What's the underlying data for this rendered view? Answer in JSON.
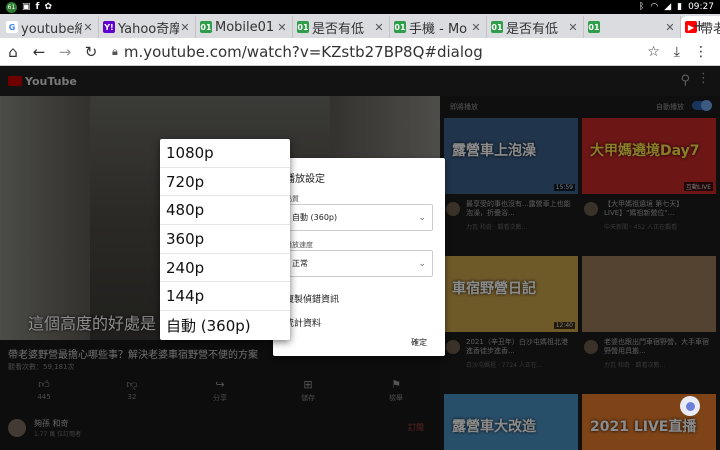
{
  "status_bar": {
    "left_icons": [
      "notification-badge-icon",
      "photo-icon",
      "facebook-icon",
      "battery-saver-icon"
    ],
    "badge_count": "61",
    "time": "09:27",
    "right_icons": [
      "bluetooth-icon",
      "wifi-icon",
      "signal-icon",
      "battery-icon"
    ]
  },
  "tabs": [
    {
      "title": "youtube縮",
      "favicon": "G",
      "fav_color": "#ffffff",
      "fav_text_color": "#4285f4",
      "active": false
    },
    {
      "title": "Yahoo奇摩",
      "favicon": "Y!",
      "fav_color": "#5f01d1",
      "fav_text_color": "#ffffff",
      "active": false
    },
    {
      "title": "Mobile01",
      "favicon": "01",
      "fav_color": "#2e9e4a",
      "fav_text_color": "#ffffff",
      "active": false
    },
    {
      "title": "是否有低",
      "favicon": "01",
      "fav_color": "#2e9e4a",
      "fav_text_color": "#ffffff",
      "active": false
    },
    {
      "title": "手機 - Mo",
      "favicon": "01",
      "fav_color": "#2e9e4a",
      "fav_text_color": "#ffffff",
      "active": false
    },
    {
      "title": "是否有低",
      "favicon": "01",
      "fav_color": "#2e9e4a",
      "fav_text_color": "#ffffff",
      "active": false
    },
    {
      "title": "",
      "favicon": "01",
      "fav_color": "#2e9e4a",
      "fav_text_color": "#ffffff",
      "active": false
    },
    {
      "title": "帶老婆野",
      "favicon": "▶",
      "fav_color": "#ff0000",
      "fav_text_color": "#ffffff",
      "active": true
    }
  ],
  "new_tab_label": "+",
  "address_bar": {
    "url": "m.youtube.com/watch?v=KZstb27BP8Q#dialog",
    "icons": [
      "home-icon",
      "back-icon",
      "forward-icon",
      "reload-icon",
      "lock-icon",
      "star-icon",
      "download-icon",
      "menu-icon"
    ]
  },
  "youtube": {
    "logo_text": "YouTube",
    "video_caption": "這個高度的好處是",
    "video_title": "帶老婆野營最擔心哪些事？解決老婆車宿野營不便的方案",
    "video_meta": "觀看次數：59,181次",
    "actions": [
      {
        "icon": "thumbs-up-icon",
        "label": "445"
      },
      {
        "icon": "thumbs-down-icon",
        "label": "32"
      },
      {
        "icon": "share-icon",
        "label": "分享"
      },
      {
        "icon": "save-icon",
        "label": "儲存"
      },
      {
        "icon": "flag-icon",
        "label": "檢舉"
      }
    ],
    "channel_name": "夠孫 和奇",
    "channel_subs": "1.77 萬 位訂閱者",
    "subscribe_label": "訂閱"
  },
  "sidebar": {
    "heading": "即將播放",
    "autoplay_label": "自動播放",
    "autoplay_on": true,
    "videos": [
      {
        "thumb_text": "露營車上泡澡",
        "thumb_color": "#3b5f8a",
        "text_color": "#ffffff",
        "title": "最享受的事也沒有...露營車上也能泡澡，折疊浴...",
        "sub": "力瓦 和奇 · 觀看次數...",
        "duration": "15:59"
      },
      {
        "thumb_text": "大甲媽遶境Day7",
        "thumb_color": "#c62828",
        "text_color": "#ffe34d",
        "title": "【大甲媽祖遶境 第七天】LIVE】\"媽祖新營位\"...",
        "sub": "中天新聞 · 452 人正在觀看",
        "duration": "互動LIVE"
      },
      {
        "thumb_text": "車宿野營日記",
        "thumb_color": "#c9a24a",
        "text_color": "#ffffff",
        "title": "2021（辛丑年）白沙屯媽祖北港進香徒步進香...",
        "sub": "白沙屯媽祖 · 7724 人正在...",
        "duration": "12:40"
      },
      {
        "thumb_text": "",
        "thumb_color": "#9a7a58",
        "text_color": "#ffffff",
        "title": "老婆也跟出門車宿野營，大手車宿野營用具搬...",
        "sub": "力瓦 和奇 · 觀看次數...",
        "duration": ""
      },
      {
        "thumb_text": "露營車大改造",
        "thumb_color": "#4a90c2",
        "text_color": "#ffffff",
        "title": "",
        "sub": "",
        "duration": ""
      },
      {
        "thumb_text": "2021 LIVE直播",
        "thumb_color": "#e57c2c",
        "text_color": "#ffffff",
        "title": "",
        "sub": "",
        "duration": ""
      }
    ]
  },
  "playback_dialog": {
    "title": "播放設定",
    "quality_label": "品質",
    "quality_value": "自動 (360p)",
    "speed_label": "播放速度",
    "speed_value": "正常",
    "option_copy_debug": "複製偵錯資訊",
    "option_stats": "統計資料",
    "ok_label": "確定"
  },
  "quality_dropdown": {
    "options": [
      "1080p",
      "720p",
      "480p",
      "360p",
      "240p",
      "144p",
      "自動 (360p)"
    ]
  }
}
